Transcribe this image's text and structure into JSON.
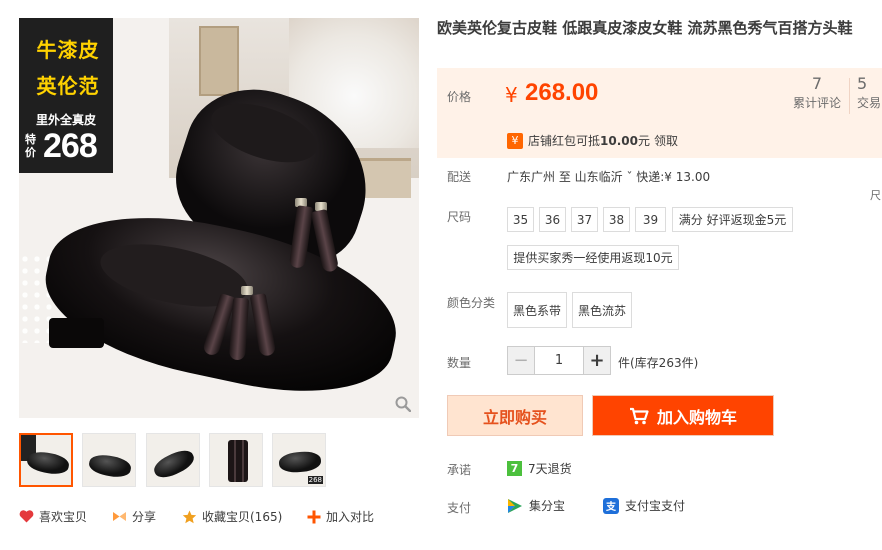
{
  "gallery": {
    "promo": {
      "line1": "牛漆皮",
      "line2": "英伦范",
      "line3": "里外全真皮",
      "special": "特价",
      "price": "268"
    },
    "thumbnail_badge": "268"
  },
  "product": {
    "title": "欧美英伦复古皮鞋 低跟真皮漆皮女鞋 流苏黑色秀气百搭方头鞋"
  },
  "price": {
    "label": "价格",
    "currency": "¥",
    "value": "268.00",
    "reviews_count": "7",
    "reviews_label": "累计评论",
    "trades_count": "5",
    "trades_label": "交易"
  },
  "coupon": {
    "icon": "¥",
    "prefix": "店铺红包可抵",
    "amount": "10.00",
    "unit": "元",
    "action": "领取"
  },
  "shipping": {
    "label": "配送",
    "text": "广东广州  至  山东临沂 ˇ  快递:¥ 13.00",
    "edge_text": "尺"
  },
  "size": {
    "label": "尺码",
    "options": [
      "35",
      "36",
      "37",
      "38",
      "39"
    ],
    "promo1": "满分 好评返现金5元",
    "promo2": "提供买家秀一经使用返现10元"
  },
  "color": {
    "label": "颜色分类",
    "options": [
      "黑色系带",
      "黑色流苏"
    ]
  },
  "quantity": {
    "label": "数量",
    "minus": "−",
    "plus": "+",
    "value": "1",
    "stock": "件(库存263件)"
  },
  "buttons": {
    "buy_now": "立即购买",
    "add_cart": "加入购物车"
  },
  "promise": {
    "label": "承诺",
    "icon": "7",
    "text": "7天退货"
  },
  "payment": {
    "label": "支付",
    "method1": "集分宝",
    "method2": "支付宝支付"
  },
  "actions": {
    "like": "喜欢宝贝",
    "share": "分享",
    "favorite": "收藏宝贝(165)",
    "compare": "加入对比"
  },
  "colors": {
    "accent": "#ff4400",
    "price_bg": "#fff2e8",
    "buy_now_bg": "#ffe4d0",
    "promise_green": "#4cc03d"
  }
}
